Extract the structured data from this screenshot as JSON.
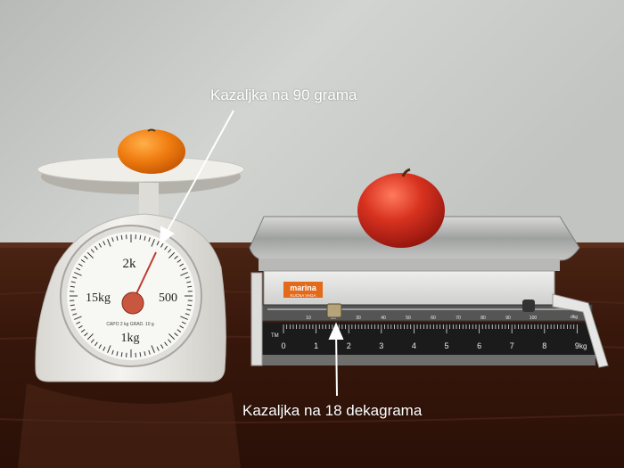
{
  "annotations": {
    "top_label": "Kazaljka na 90 grama",
    "bottom_label": "Kazaljka na 18 dekagrama"
  },
  "dial_scale": {
    "label_2kg": "2k",
    "label_15kg": "15kg",
    "label_500": "500",
    "label_1kg": "1kg",
    "small_print": "CAPO 2 kg   GRAD. 10 g"
  },
  "beam_scale": {
    "brand": "marina",
    "brand_sub": "KUĆNA VAGA",
    "badge": "TM",
    "main_numbers": [
      "0",
      "1",
      "2",
      "3",
      "4",
      "5",
      "6",
      "7",
      "8",
      "9"
    ],
    "main_unit": "kg",
    "fine_numbers": [
      "10",
      "20",
      "30",
      "40",
      "50",
      "60",
      "70",
      "80",
      "90",
      "100"
    ],
    "fine_unit": "dkg"
  },
  "readings": {
    "dial_grams": 90,
    "beam_dekagrams": 18
  },
  "colors": {
    "wall": "#c9cbc8",
    "table": "#3d1a0e",
    "orange": "#f07c10",
    "apple": "#c8251b",
    "annotation": "#ffffff"
  }
}
